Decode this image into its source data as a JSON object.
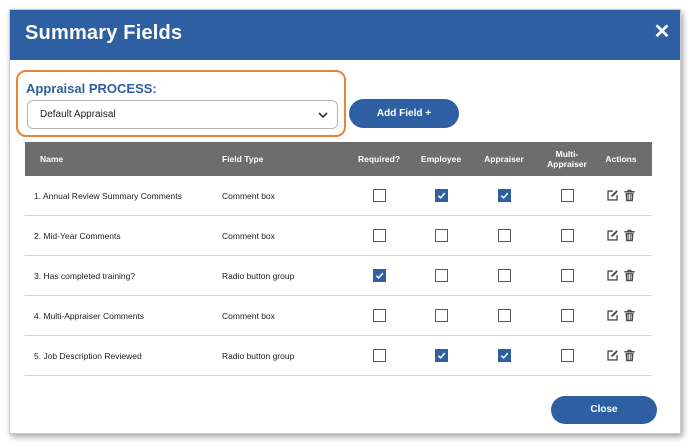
{
  "dialog": {
    "title": "Summary Fields",
    "close_glyph": "✕"
  },
  "process": {
    "label": "Appraisal PROCESS:",
    "selected": "Default Appraisal"
  },
  "add_field_label": "Add Field +",
  "table": {
    "headers": {
      "name": "Name",
      "field_type": "Field Type",
      "required": "Required?",
      "employee": "Employee",
      "appraiser": "Appraiser",
      "multi_appraiser_line1": "Multi-",
      "multi_appraiser_line2": "Appraiser",
      "actions": "Actions"
    },
    "rows": [
      {
        "name": "1. Annual Review Summary Comments",
        "field_type": "Comment box",
        "required": false,
        "employee": true,
        "appraiser": true,
        "multi_appraiser": false
      },
      {
        "name": "2. Mid-Year Comments",
        "field_type": "Comment box",
        "required": false,
        "employee": false,
        "appraiser": false,
        "multi_appraiser": false
      },
      {
        "name": "3. Has completed training?",
        "field_type": "Radio button group",
        "required": true,
        "employee": false,
        "appraiser": false,
        "multi_appraiser": false
      },
      {
        "name": "4. Multi-Appraiser Comments",
        "field_type": "Comment box",
        "required": false,
        "employee": false,
        "appraiser": false,
        "multi_appraiser": false
      },
      {
        "name": "5. Job Description Reviewed",
        "field_type": "Radio button group",
        "required": false,
        "employee": true,
        "appraiser": true,
        "multi_appraiser": false
      }
    ]
  },
  "close_label": "Close",
  "colors": {
    "primary": "#2e5fa3",
    "highlight": "#e8833a",
    "table_header": "#6d6d6d"
  },
  "icons": [
    "close-icon",
    "chevron-down-icon",
    "edit-icon",
    "trash-icon",
    "checkmark-icon"
  ]
}
